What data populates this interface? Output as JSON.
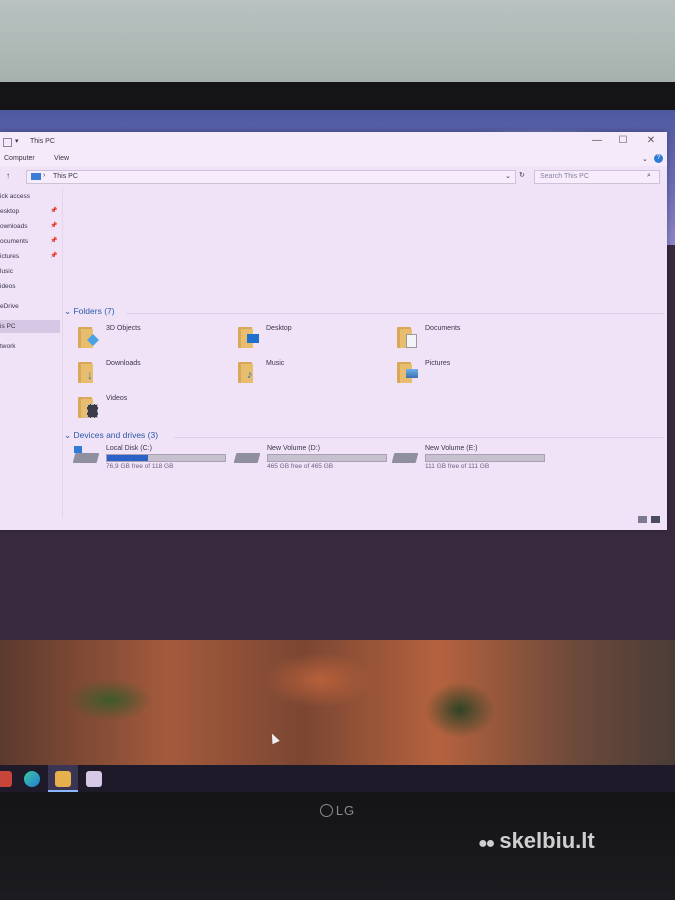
{
  "window": {
    "title": "This PC",
    "controls": {
      "minimize": "—",
      "maximize": "☐",
      "close": "✕"
    },
    "ribbon_tabs": [
      "Computer",
      "View"
    ],
    "address": {
      "path": "This PC",
      "separator": "›"
    },
    "search_placeholder": "Search This PC"
  },
  "nav": {
    "items": [
      {
        "label": "ick access",
        "pinned": false
      },
      {
        "label": "esktop",
        "pinned": true
      },
      {
        "label": "ownloads",
        "pinned": true
      },
      {
        "label": "ocuments",
        "pinned": true
      },
      {
        "label": "ictures",
        "pinned": true
      },
      {
        "label": "lusic",
        "pinned": false
      },
      {
        "label": "ideos",
        "pinned": false
      },
      {
        "label": "eDrive",
        "pinned": false
      },
      {
        "label": "is PC",
        "pinned": false,
        "selected": true
      },
      {
        "label": "twork",
        "pinned": false
      }
    ]
  },
  "folders": {
    "header": "Folders (7)",
    "items": [
      {
        "name": "3D Objects",
        "icon": "3d-objects-icon"
      },
      {
        "name": "Desktop",
        "icon": "desktop-icon"
      },
      {
        "name": "Documents",
        "icon": "documents-icon"
      },
      {
        "name": "Downloads",
        "icon": "downloads-icon"
      },
      {
        "name": "Music",
        "icon": "music-icon"
      },
      {
        "name": "Pictures",
        "icon": "pictures-icon"
      },
      {
        "name": "Videos",
        "icon": "videos-icon"
      }
    ]
  },
  "drives": {
    "header": "Devices and drives (3)",
    "items": [
      {
        "name": "Local Disk (C:)",
        "free": "76,9 GB free of 118 GB",
        "used_fraction": 0.35
      },
      {
        "name": "New Volume (D:)",
        "free": "465 GB free of 465 GB",
        "used_fraction": 0.0
      },
      {
        "name": "New Volume (E:)",
        "free": "111 GB free of 111 GB",
        "used_fraction": 0.0
      }
    ]
  },
  "monitor": {
    "brand": "LG"
  },
  "watermark": "skelbiu.lt",
  "colors": {
    "accent": "#2a62c7",
    "section_header": "#2b5aa8",
    "window_bg": "#f0e3f8"
  }
}
